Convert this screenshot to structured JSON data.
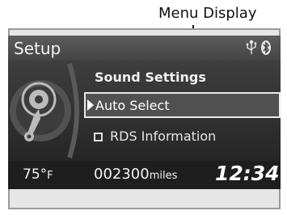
{
  "callout": {
    "label": "Menu Display"
  },
  "screen": {
    "title": "Setup",
    "status_icons": [
      "usb-icon",
      "bluetooth-icon"
    ],
    "category_icon": "settings-wrench-icon",
    "menu": {
      "header": "Sound Settings",
      "items": [
        {
          "label": "Auto Select",
          "selected": true,
          "checkbox": false
        },
        {
          "label": "RDS Information",
          "selected": false,
          "checkbox": true,
          "checked": false
        }
      ]
    },
    "bottom": {
      "temperature": "75°",
      "temperature_unit": "F",
      "odometer": "002300",
      "odometer_unit": "miles",
      "clock": "12:34"
    }
  },
  "colors": {
    "screen_bg": "#2d2d2d",
    "topbar": "#4f4f4f",
    "highlight_border": "#eaeaea",
    "text": "#f2f2f2"
  }
}
